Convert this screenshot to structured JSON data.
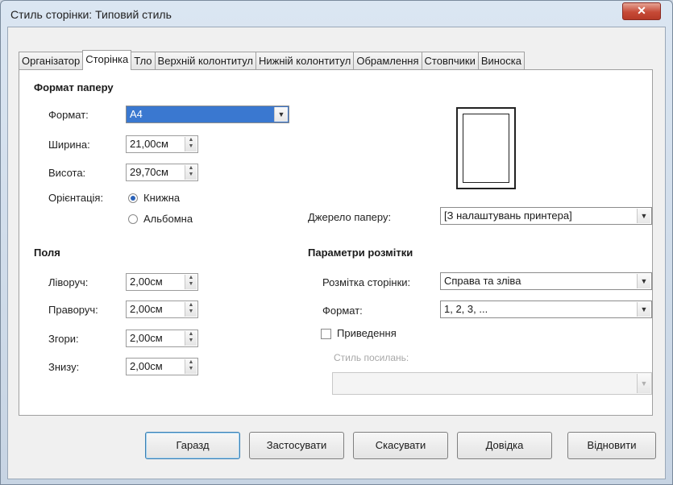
{
  "window": {
    "title": "Стиль сторінки: Типовий стиль",
    "close_label": "✕"
  },
  "tabs": [
    "Організатор",
    "Сторінка",
    "Тло",
    "Верхній колонтитул",
    "Нижній колонтитул",
    "Обрамлення",
    "Стовпчики",
    "Виноска"
  ],
  "active_tab": "Сторінка",
  "paper_format": {
    "section_title": "Формат паперу",
    "format_label": "Формат:",
    "format_value": "A4",
    "width_label": "Ширина:",
    "width_value": "21,00см",
    "height_label": "Висота:",
    "height_value": "29,70см",
    "orientation_label": "Орієнтація:",
    "orientation_portrait": "Книжна",
    "orientation_landscape": "Альбомна",
    "orientation_selected": "portrait"
  },
  "paper_source": {
    "label": "Джерело паперу:",
    "value": "[З налаштувань принтера]"
  },
  "margins": {
    "section_title": "Поля",
    "left_label": "Ліворуч:",
    "left_value": "2,00см",
    "right_label": "Праворуч:",
    "right_value": "2,00см",
    "top_label": "Згори:",
    "top_value": "2,00см",
    "bottom_label": "Знизу:",
    "bottom_value": "2,00см"
  },
  "layout": {
    "section_title": "Параметри розмітки",
    "page_layout_label": "Розмітка сторінки:",
    "page_layout_value": "Справа та зліва",
    "format_label": "Формат:",
    "format_value": "1, 2, 3, ...",
    "register_label": "Приведення",
    "register_checked": false,
    "ref_style_label": "Стиль посилань:",
    "ref_style_value": ""
  },
  "buttons": {
    "ok": "Гаразд",
    "apply": "Застосувати",
    "cancel": "Скасувати",
    "help": "Довідка",
    "reset": "Відновити"
  },
  "icons": {
    "dropdown": "▼",
    "spin_up": "▲",
    "spin_down": "▼"
  }
}
